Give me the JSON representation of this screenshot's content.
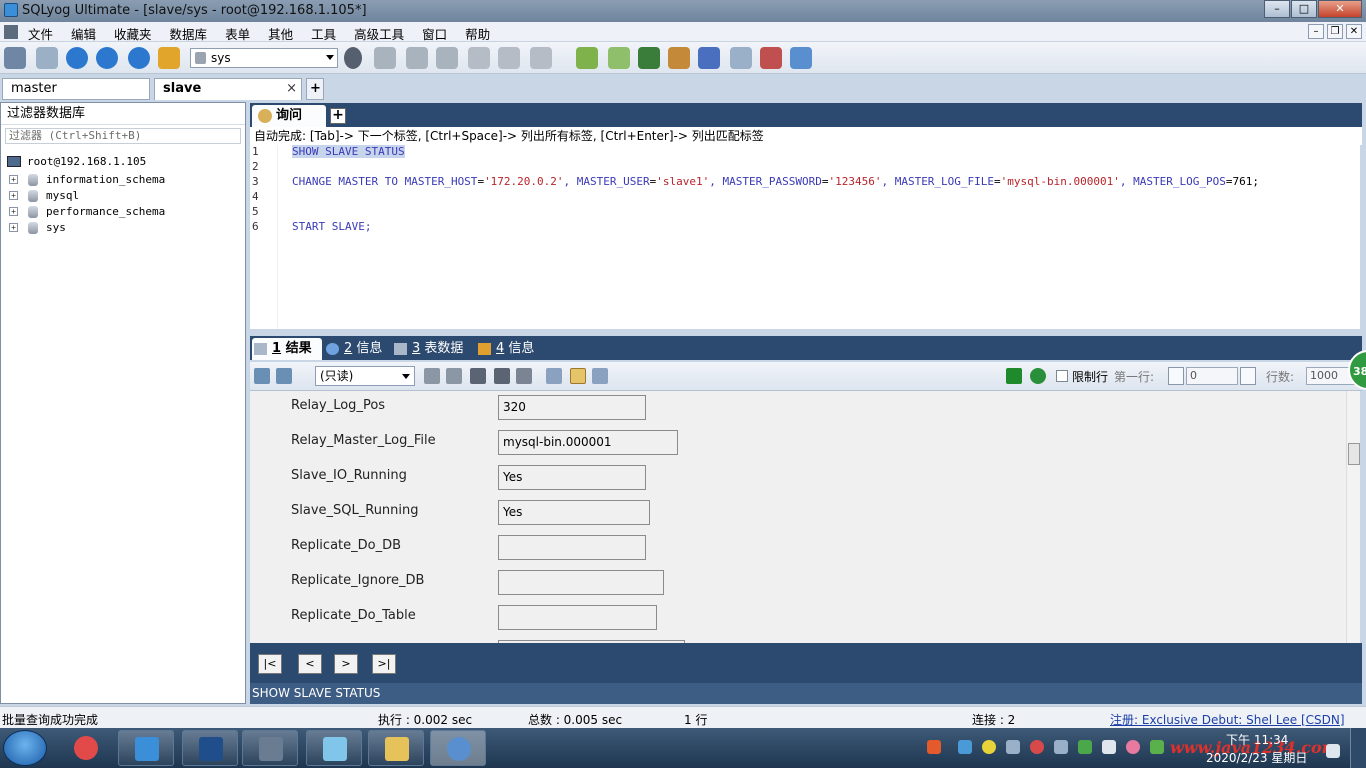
{
  "window": {
    "title": "SQLyog Ultimate - [slave/sys - root@192.168.1.105*]"
  },
  "menu": [
    "文件",
    "编辑",
    "收藏夹",
    "数据库",
    "表单",
    "其他",
    "工具",
    "高级工具",
    "窗口",
    "帮助"
  ],
  "toolbar": {
    "db_select": "sys"
  },
  "connections": {
    "tabs": [
      "master",
      "slave"
    ],
    "active": "slave",
    "close_glyph": "×",
    "add_glyph": "+"
  },
  "object_browser": {
    "title": "过滤器数据库",
    "filter_placeholder": "过滤器 (Ctrl+Shift+B)",
    "root": "root@192.168.1.105",
    "databases": [
      "information_schema",
      "mysql",
      "performance_schema",
      "sys"
    ],
    "expander": "+"
  },
  "query_tab": {
    "label": "询问",
    "add_glyph": "+"
  },
  "autocomplete_hint": "自动完成: [Tab]-> 下一个标签, [Ctrl+Space]-> 列出所有标签, [Ctrl+Enter]-> 列出匹配标签",
  "editor": {
    "line_numbers": [
      "1",
      "2",
      "3",
      "4",
      "5",
      "6"
    ],
    "line1": "SHOW SLAVE STATUS",
    "line3": {
      "kw1": "CHANGE MASTER TO MASTER_HOST",
      "eq": "=",
      "s1": "'172.20.0.2'",
      "kw2": ", MASTER_USER",
      "s2": "'slave1'",
      "kw3": ", MASTER_PASSWORD",
      "s3": "'123456'",
      "kw4": ", MASTER_LOG_FILE",
      "s4": "'mysql-bin.000001'",
      "kw5": ", MASTER_LOG_POS",
      "tail": "761;"
    },
    "line6": "START SLAVE;"
  },
  "result_tabs": [
    {
      "num": "1",
      "label": " 结果"
    },
    {
      "num": "2",
      "label": " 信息"
    },
    {
      "num": "3",
      "label": " 表数据"
    },
    {
      "num": "4",
      "label": " 信息"
    }
  ],
  "result_toolbar": {
    "mode_select": "(只读)",
    "limit_label": "限制行",
    "first_row_label": "第一行:",
    "first_row_value": "0",
    "rows_label": "行数:",
    "rows_value": "1000"
  },
  "form_rows": [
    {
      "label": "Relay_Log_Pos",
      "value": "320"
    },
    {
      "label": "Relay_Master_Log_File",
      "value": "mysql-bin.000001"
    },
    {
      "label": "Slave_IO_Running",
      "value": "Yes"
    },
    {
      "label": "Slave_SQL_Running",
      "value": "Yes"
    },
    {
      "label": "Replicate_Do_DB",
      "value": ""
    },
    {
      "label": "Replicate_Ignore_DB",
      "value": ""
    },
    {
      "label": "Replicate_Do_Table",
      "value": ""
    }
  ],
  "record_nav": [
    "|<",
    "<",
    ">",
    ">|"
  ],
  "query_label": "SHOW SLAVE STATUS",
  "status": {
    "message": "批量查询成功完成",
    "exec": "执行 : 0.002 sec",
    "total": "总数 : 0.005 sec",
    "rows": "1 行",
    "connections": "连接 : 2",
    "registration": "注册:  Exclusive Debut: Shel Lee [CSDN]"
  },
  "taskbar": {
    "time": "下午 11:34",
    "date": "2020/2/23 星期日",
    "watermark": "www.java1234.com"
  },
  "badge": "38",
  "colors": {
    "panel_dark": "#2c4a6f",
    "keyword": "#3a3ab8",
    "string": "#b8232a"
  }
}
